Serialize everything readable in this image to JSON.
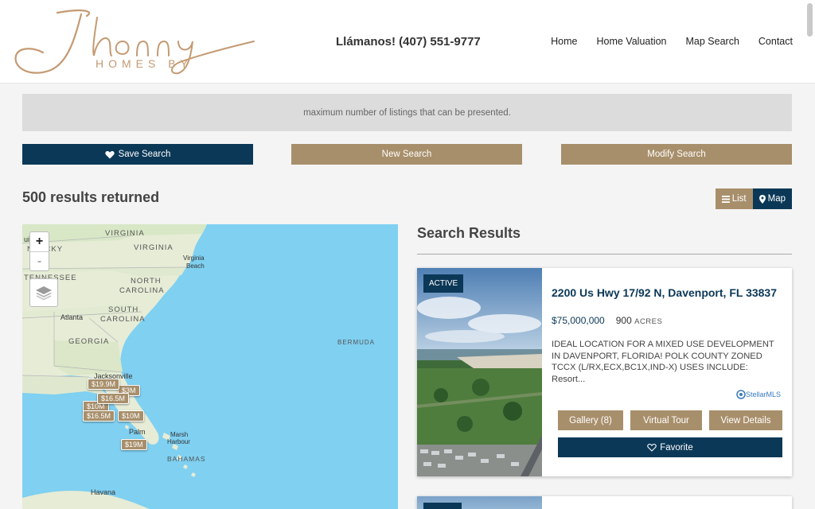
{
  "header": {
    "logo": {
      "script": "Jhonny",
      "tagline": "HOMES BY"
    },
    "phone": "Llámanos! (407) 551-9777",
    "nav": [
      "Home",
      "Home Valuation",
      "Map Search",
      "Contact"
    ]
  },
  "notice": "maximum number of listings that can be presented.",
  "actions": {
    "save": "Save Search",
    "new": "New Search",
    "modify": "Modify Search"
  },
  "results_count": "500 results returned",
  "view_toggle": {
    "list": "List",
    "map": "Map"
  },
  "map": {
    "zoom_in": "+",
    "zoom_out": "-",
    "labels": {
      "virginia_top": "VIRGINIA",
      "kentucky": "NTUCKY",
      "virginia": "VIRGINIA",
      "tennessee": "TENNESSEE",
      "north_carolina_1": "NORTH",
      "north_carolina_2": "CAROLINA",
      "south_carolina_1": "SOUTH",
      "south_carolina_2": "CAROLINA",
      "georgia": "GEORGIA",
      "bermuda": "BERMUDA",
      "bahamas": "BAHAMAS"
    },
    "cities": {
      "louisville": "uisville",
      "virginia_beach_1": "Virginia",
      "virginia_beach_2": "Beach",
      "atlanta": "Atlanta",
      "jacksonville": "Jacksonville",
      "palm": "Palm",
      "marsh_harbour_1": "Marsh",
      "marsh_harbour_2": "Harbour",
      "havana": "Havana"
    },
    "markers": [
      "$19.9M",
      "$16.5M",
      "$16.5M",
      "$19M",
      "$3M",
      "$10M",
      "$10M"
    ]
  },
  "search_results_title": "Search Results",
  "listing": {
    "status": "ACTIVE",
    "address": "2200 Us Hwy 17/92 N, Davenport, FL 33837",
    "price": "$75,000,000",
    "acres": "900",
    "acres_unit": "ACRES",
    "description": "IDEAL LOCATION FOR A MIXED USE DEVELOPMENT IN DAVENPORT, FLORIDA! POLK COUNTY ZONED TCCX (L/RX,ECX,BC1X,IND-X) USES INCLUDE: Resort...",
    "mls": "StellarMLS",
    "buttons": {
      "gallery": "Gallery (8)",
      "tour": "Virtual Tour",
      "details": "View Details",
      "favorite": "Favorite"
    }
  },
  "colors": {
    "navy": "#0b3857",
    "tan": "#a88f6b",
    "logo": "#c49a72"
  }
}
